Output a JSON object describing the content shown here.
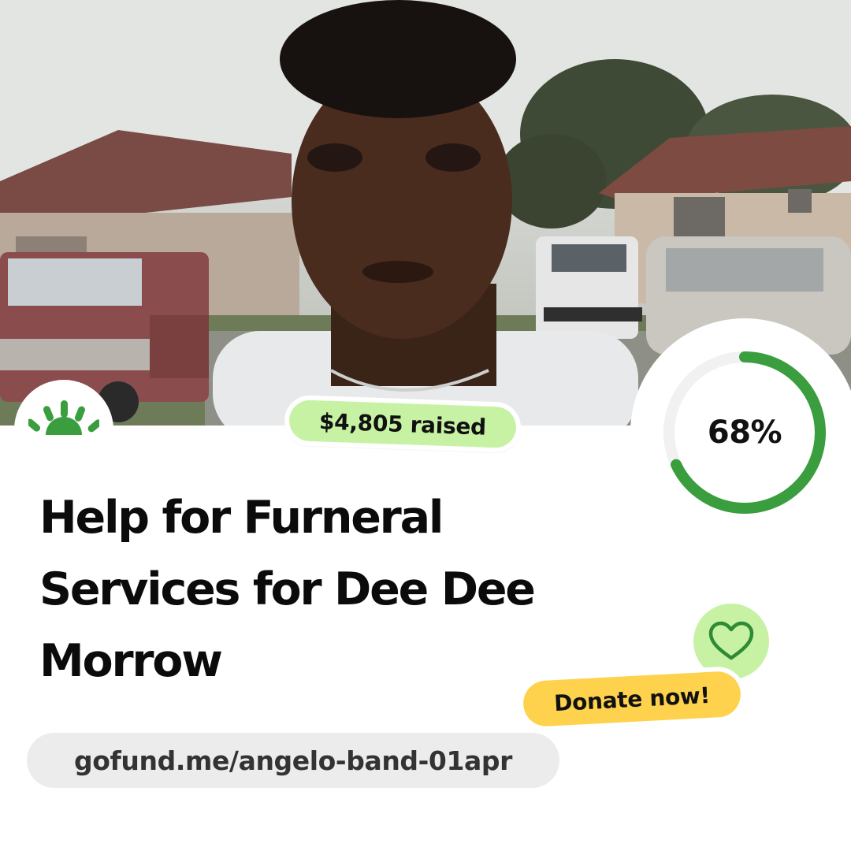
{
  "campaign": {
    "raised_label": "$4,805 raised",
    "progress_percent": 68,
    "progress_label": "68%",
    "title": "Help for Furneral Services for Dee Dee Morrow",
    "donate_label": "Donate now!",
    "url": "gofund.me/angelo-band-01apr"
  },
  "colors": {
    "brand_green": "#3a9e3f",
    "badge_green": "#c7f2a4",
    "donate_yellow": "#fed24c",
    "url_pill_gray": "#ececec"
  },
  "icons": {
    "logo": "gofundme-sunrise-icon",
    "heart": "heart-icon"
  }
}
